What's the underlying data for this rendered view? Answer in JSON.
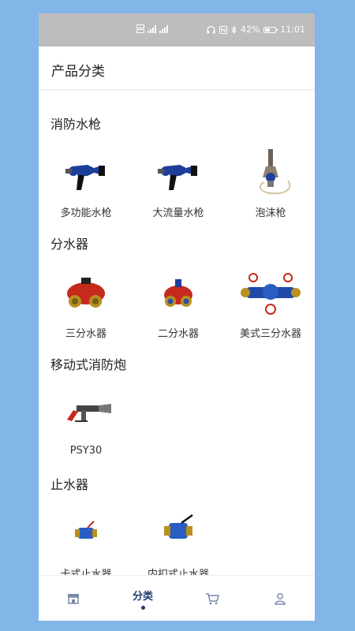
{
  "statusbar": {
    "battery": "42%",
    "time": "11:01",
    "battery_level": 0.42
  },
  "header": {
    "title": "产品分类"
  },
  "sections": [
    {
      "title": "消防水枪",
      "items": [
        {
          "label": "多功能水枪",
          "icon": "nozzle-image"
        },
        {
          "label": "大流量水枪",
          "icon": "nozzle-image"
        },
        {
          "label": "泡沫枪",
          "icon": "foam-nozzle-image"
        }
      ]
    },
    {
      "title": "分水器",
      "items": [
        {
          "label": "三分水器",
          "icon": "divider-image"
        },
        {
          "label": "二分水器",
          "icon": "divider-image"
        },
        {
          "label": "美式三分水器",
          "icon": "divider-image"
        }
      ]
    },
    {
      "title": "移动式消防炮",
      "items": [
        {
          "label": "PSY30",
          "icon": "monitor-image"
        }
      ]
    },
    {
      "title": "止水器",
      "items": [
        {
          "label": "卡式止水器",
          "icon": "valve-image"
        },
        {
          "label": "内扣式止水器",
          "icon": "valve-image"
        }
      ]
    }
  ],
  "tabs": [
    {
      "label": "",
      "icon": "store-icon"
    },
    {
      "label": "分类",
      "icon": "",
      "active": true
    },
    {
      "label": "",
      "icon": "cart-icon"
    },
    {
      "label": "",
      "icon": "user-icon"
    }
  ],
  "colors": {
    "accent": "#1f3a6e",
    "background": "#82b5e8",
    "statusbar": "#bdbdbd"
  }
}
